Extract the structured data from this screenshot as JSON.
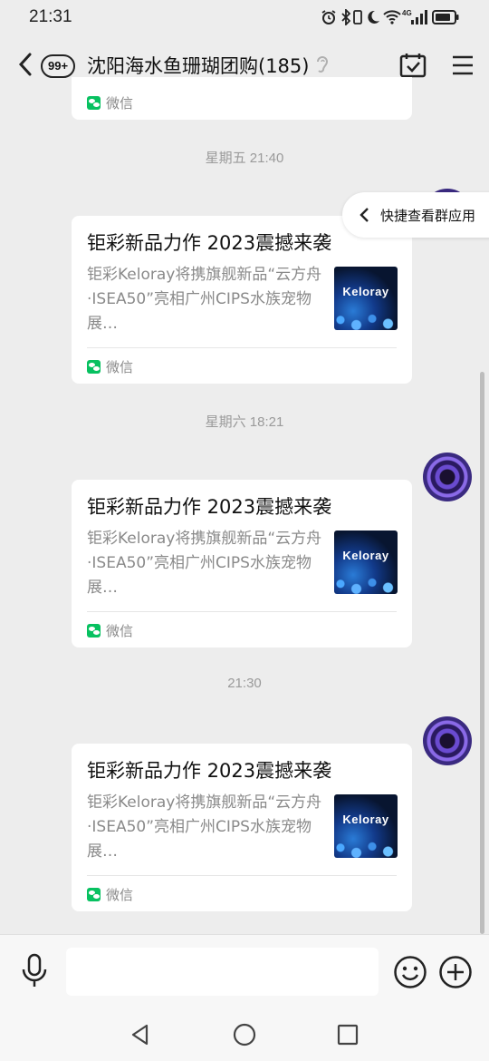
{
  "status_bar": {
    "time": "21:31",
    "network_label": "4G"
  },
  "nav": {
    "unread_badge": "99+",
    "title": "沈阳海水鱼珊瑚团购(185)"
  },
  "top_card_source": "微信",
  "quick_view": {
    "label": "快捷查看群应用"
  },
  "messages": [
    {
      "timestamp": "星期五 21:40",
      "title": "钜彩新品力作 2023震撼来袭",
      "desc": "钜彩Keloray将携旗舰新品“云方舟·ISEA50”亮相广州CIPS水族宠物展…",
      "thumb_text": "Keloray",
      "source": "微信"
    },
    {
      "timestamp": "星期六 18:21",
      "title": "钜彩新品力作 2023震撼来袭",
      "desc": "钜彩Keloray将携旗舰新品“云方舟·ISEA50”亮相广州CIPS水族宠物展…",
      "thumb_text": "Keloray",
      "source": "微信"
    },
    {
      "timestamp": "21:30",
      "title": "钜彩新品力作 2023震撼来袭",
      "desc": "钜彩Keloray将携旗舰新品“云方舟·ISEA50”亮相广州CIPS水族宠物展…",
      "thumb_text": "Keloray",
      "source": "微信"
    }
  ],
  "input": {
    "placeholder": ""
  },
  "colors": {
    "background": "#ededed",
    "wechat_green": "#07c160",
    "card": "#ffffff"
  }
}
